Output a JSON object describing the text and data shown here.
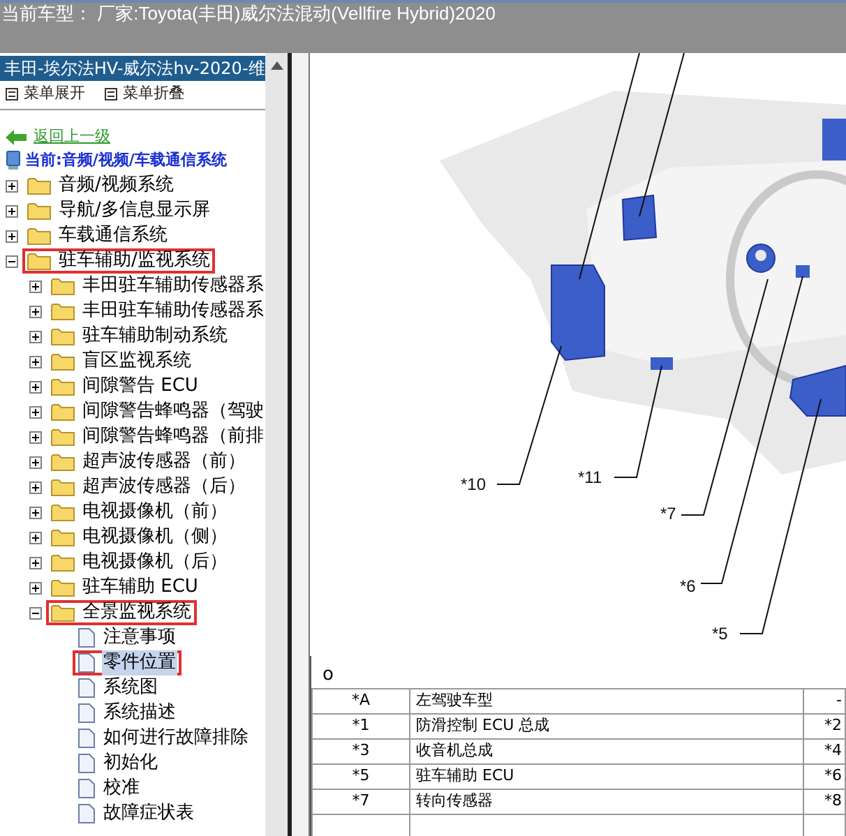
{
  "title": "当前车型：  厂家:Toyota(丰田)威尔法混动(Vellfire Hybrid)2020",
  "sidebar": {
    "header": "丰田-埃尔法HV-威尔法hv-2020-维",
    "menu": [
      "菜单展开",
      "菜单折叠"
    ],
    "back_link": "返回上一级",
    "current_path": "当前:音频/视频/车载通信系统",
    "tree": [
      {
        "label": "音频/视频系统",
        "kind": "folder",
        "expanded": false,
        "highlighted": false,
        "selected": false
      },
      {
        "label": "导航/多信息显示屏",
        "kind": "folder",
        "expanded": false,
        "highlighted": false,
        "selected": false
      },
      {
        "label": "车载通信系统",
        "kind": "folder",
        "expanded": false,
        "highlighted": false,
        "selected": false
      },
      {
        "label": "驻车辅助/监视系统",
        "kind": "folder",
        "expanded": true,
        "highlighted": true,
        "selected": false,
        "children": [
          {
            "label": "丰田驻车辅助传感器系",
            "kind": "folder",
            "expanded": false,
            "highlighted": false,
            "selected": false
          },
          {
            "label": "丰田驻车辅助传感器系",
            "kind": "folder",
            "expanded": false,
            "highlighted": false,
            "selected": false
          },
          {
            "label": "驻车辅助制动系统",
            "kind": "folder",
            "expanded": false,
            "highlighted": false,
            "selected": false
          },
          {
            "label": "盲区监视系统",
            "kind": "folder",
            "expanded": false,
            "highlighted": false,
            "selected": false
          },
          {
            "label": "间隙警告 ECU",
            "kind": "folder",
            "expanded": false,
            "highlighted": false,
            "selected": false
          },
          {
            "label": "间隙警告蜂鸣器（驾驶",
            "kind": "folder",
            "expanded": false,
            "highlighted": false,
            "selected": false
          },
          {
            "label": "间隙警告蜂鸣器（前排",
            "kind": "folder",
            "expanded": false,
            "highlighted": false,
            "selected": false
          },
          {
            "label": "超声波传感器（前）",
            "kind": "folder",
            "expanded": false,
            "highlighted": false,
            "selected": false
          },
          {
            "label": "超声波传感器（后）",
            "kind": "folder",
            "expanded": false,
            "highlighted": false,
            "selected": false
          },
          {
            "label": "电视摄像机（前）",
            "kind": "folder",
            "expanded": false,
            "highlighted": false,
            "selected": false
          },
          {
            "label": "电视摄像机（侧）",
            "kind": "folder",
            "expanded": false,
            "highlighted": false,
            "selected": false
          },
          {
            "label": "电视摄像机（后）",
            "kind": "folder",
            "expanded": false,
            "highlighted": false,
            "selected": false
          },
          {
            "label": "驻车辅助 ECU",
            "kind": "folder",
            "expanded": false,
            "highlighted": false,
            "selected": false
          },
          {
            "label": "全景监视系统",
            "kind": "folder",
            "expanded": true,
            "highlighted": true,
            "selected": false,
            "children": [
              {
                "label": "注意事项",
                "kind": "page",
                "highlighted": false,
                "selected": false
              },
              {
                "label": "零件位置",
                "kind": "page",
                "highlighted": true,
                "selected": true
              },
              {
                "label": "系统图",
                "kind": "page",
                "highlighted": false,
                "selected": false
              },
              {
                "label": "系统描述",
                "kind": "page",
                "highlighted": false,
                "selected": false
              },
              {
                "label": "如何进行故障排除",
                "kind": "page",
                "highlighted": false,
                "selected": false
              },
              {
                "label": "初始化",
                "kind": "page",
                "highlighted": false,
                "selected": false
              },
              {
                "label": "校准",
                "kind": "page",
                "highlighted": false,
                "selected": false
              },
              {
                "label": "故障症状表",
                "kind": "page",
                "highlighted": false,
                "selected": false
              }
            ]
          }
        ]
      }
    ]
  },
  "diagram": {
    "callouts": [
      "*10",
      "*11",
      "*7",
      "*6",
      "*5"
    ],
    "caption": "o"
  },
  "table": {
    "rows": [
      [
        "*A",
        "左驾驶车型",
        "-"
      ],
      [
        "*1",
        "防滑控制 ECU 总成",
        "*2"
      ],
      [
        "*3",
        "收音机总成",
        "*4"
      ],
      [
        "*5",
        "驻车辅助 ECU",
        "*6"
      ],
      [
        "*7",
        "转向传感器",
        "*8"
      ]
    ]
  }
}
